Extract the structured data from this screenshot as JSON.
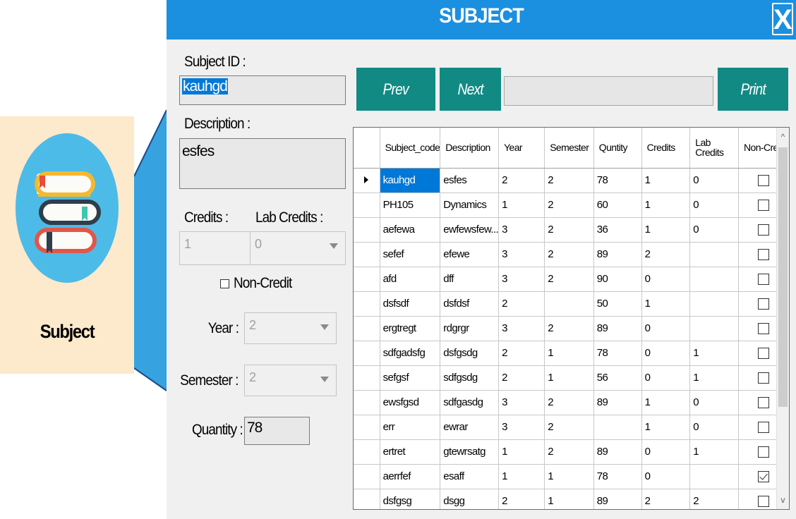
{
  "badge": {
    "label": "Subject"
  },
  "window": {
    "title": "SUBJECT",
    "close_label": "X"
  },
  "form": {
    "subject_id_label": "Subject ID :",
    "subject_id_value": "kauhgd",
    "description_label": "Description :",
    "description_value": "esfes",
    "credits_label": "Credits :",
    "credits_value": "1",
    "lab_credits_label": "Lab Credits :",
    "lab_credits_value": "0",
    "non_credit_label": "Non-Credit",
    "year_label": "Year :",
    "year_value": "2",
    "semester_label": "Semester :",
    "semester_value": "2",
    "quantity_label": "Quantity :",
    "quantity_value": "78"
  },
  "toolbar": {
    "prev_label": "Prev",
    "next_label": "Next",
    "print_label": "Print"
  },
  "grid": {
    "columns": [
      "Subject_code",
      "Description",
      "Year",
      "Semester",
      "Quntity",
      "Credits",
      "Lab Credits",
      "Non-Credit"
    ],
    "rows": [
      [
        "kauhgd",
        "esfes",
        "2",
        "2",
        "78",
        "1",
        "0",
        false
      ],
      [
        "PH105",
        "Dynamics",
        "1",
        "2",
        "60",
        "1",
        "0",
        false
      ],
      [
        "aefewa",
        "ewfewsfew...",
        "3",
        "2",
        "36",
        "1",
        "0",
        false
      ],
      [
        "sefef",
        "efewe",
        "3",
        "2",
        "89",
        "2",
        "",
        false
      ],
      [
        "afd",
        "dff",
        "3",
        "2",
        "90",
        "0",
        "",
        false
      ],
      [
        "dsfsdf",
        "dsfdsf",
        "2",
        "",
        "50",
        "1",
        "",
        false
      ],
      [
        "ergtregt",
        "rdgrgr",
        "3",
        "2",
        "89",
        "0",
        "",
        false
      ],
      [
        "sdfgadsfg",
        "dsfgsdg",
        "2",
        "1",
        "78",
        "0",
        "1",
        false
      ],
      [
        "sefgsf",
        "sdfgsdg",
        "2",
        "1",
        "56",
        "0",
        "1",
        false
      ],
      [
        "ewsfgsd",
        "sdfgasdg",
        "3",
        "2",
        "89",
        "1",
        "0",
        false
      ],
      [
        "err",
        "ewrar",
        "3",
        "2",
        "",
        "1",
        "0",
        false
      ],
      [
        "ertret",
        "gtewrsatg",
        "1",
        "2",
        "89",
        "0",
        "1",
        false
      ],
      [
        "aerrfef",
        "esaff",
        "1",
        "1",
        "78",
        "0",
        "",
        true
      ],
      [
        "dsfgsg",
        "dsgg",
        "2",
        "1",
        "89",
        "2",
        "2",
        false
      ]
    ]
  },
  "colors": {
    "titlebar": "#1b8fe0",
    "button": "#128a84",
    "badge_bg": "#fde9cc",
    "badge_circle": "#4dbbe7",
    "selection": "#0078d7"
  }
}
